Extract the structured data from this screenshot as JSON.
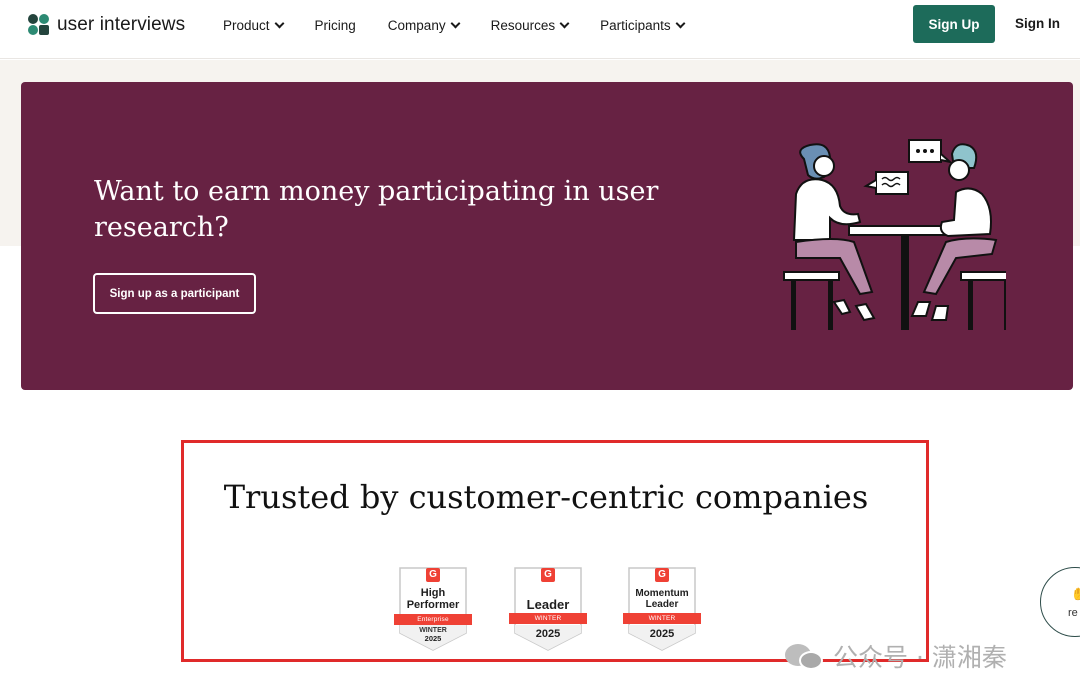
{
  "nav": {
    "logo_text": "user interviews",
    "items": [
      {
        "label": "Product",
        "has_dropdown": true
      },
      {
        "label": "Pricing",
        "has_dropdown": false
      },
      {
        "label": "Company",
        "has_dropdown": true
      },
      {
        "label": "Resources",
        "has_dropdown": true
      },
      {
        "label": "Participants",
        "has_dropdown": true
      }
    ],
    "signup_label": "Sign Up",
    "signin_label": "Sign In"
  },
  "hero": {
    "title": "Want to earn money participating in user research?",
    "button_label": "Sign up as a participant",
    "background_color": "#672243"
  },
  "trust": {
    "title": "Trusted by customer-centric companies",
    "badges": [
      {
        "logo": "G",
        "title": "High Performer",
        "ribbon": "Enterprise",
        "season": "WINTER",
        "year": "2025"
      },
      {
        "logo": "G",
        "title": "Leader",
        "ribbon": "WINTER",
        "season": "",
        "year": "2025"
      },
      {
        "logo": "G",
        "title": "Momentum Leader",
        "ribbon": "WINTER",
        "season": "",
        "year": "2025"
      }
    ]
  },
  "chat_widget": {
    "text": "re",
    "icon": "wave-icon"
  },
  "watermark": {
    "text": "公众号 · 潇湘秦",
    "icon": "wechat-icon"
  },
  "colors": {
    "brand_green": "#1d6b5a",
    "hero_bg": "#672243",
    "g2_red": "#ef4135",
    "highlight_red": "#e02a2a"
  }
}
